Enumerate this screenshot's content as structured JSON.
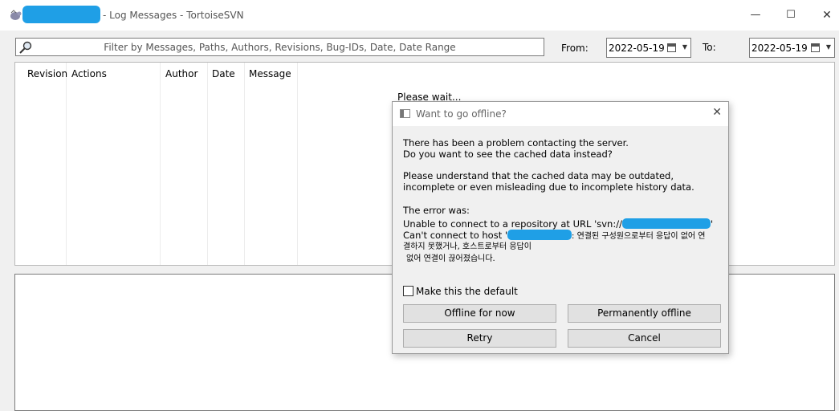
{
  "window": {
    "title": "- Log Messages - TortoiseSVN",
    "controls": {
      "minimize": "—",
      "maximize": "☐",
      "close": "✕"
    }
  },
  "filter": {
    "placeholder": "Filter by Messages, Paths, Authors, Revisions, Bug-IDs, Date, Date Range",
    "from_label": "From:",
    "from_value": "2022-05-19",
    "to_label": "To:",
    "to_value": "2022-05-19"
  },
  "log_list": {
    "columns": [
      "Revision",
      "Actions",
      "Author",
      "Date",
      "Message"
    ],
    "status": "Please wait..."
  },
  "dialog": {
    "title": "Want to go offline?",
    "close": "✕",
    "line1": "There has been a problem contacting the server.",
    "line2": "Do you want to see the cached data instead?",
    "line3": "Please understand that the cached data may be outdated,",
    "line4": "incomplete or even misleading due to incomplete history data.",
    "line5": "The error was:",
    "error_url_prefix": "Unable to connect to a repository at URL 'svn://",
    "error_url_suffix": "'",
    "error_host_prefix": "Can't connect to host '",
    "error_host_suffix": ": 연결된 구성원으로부터 응답이 없어 연",
    "error_line2": "결하지 못했거나, 호스트로부터 응답이",
    "error_line3": "없어 연결이 끊어졌습니다.",
    "checkbox_label": "Make this the default",
    "buttons": {
      "offline_now": "Offline for now",
      "permanently_offline": "Permanently offline",
      "retry": "Retry",
      "cancel": "Cancel"
    }
  },
  "colors": {
    "redaction": "#1f9fe6",
    "window_bg": "#f0f0f0"
  }
}
